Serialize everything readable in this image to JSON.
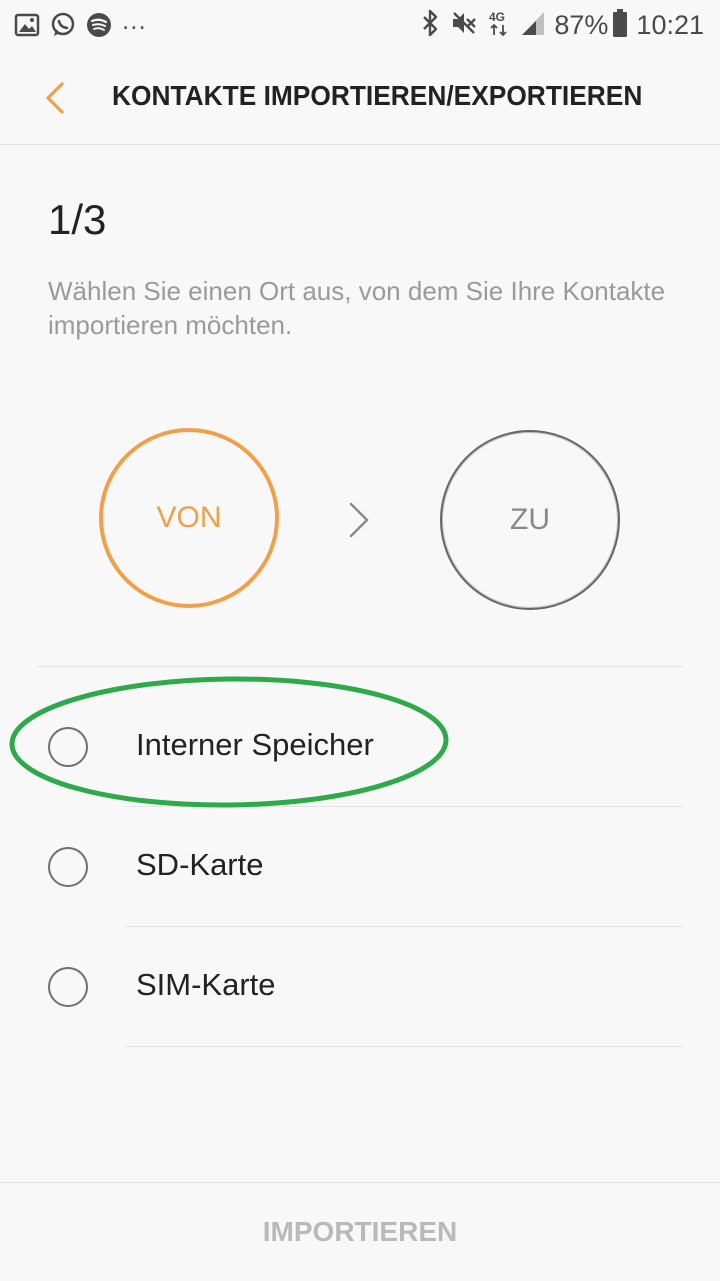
{
  "status_bar": {
    "left_icons": [
      "gallery-icon",
      "whatsapp-icon",
      "spotify-icon"
    ],
    "more": "...",
    "right_icons": [
      "bluetooth-icon",
      "mute-icon",
      "network-4g-icon",
      "signal-icon"
    ],
    "network_type": "4G",
    "battery_percent": "87%",
    "time": "10:21"
  },
  "app_bar": {
    "title": "KONTAKTE IMPORTIEREN/EXPORTIEREN",
    "back_icon": "chevron-left-icon"
  },
  "wizard": {
    "step": "1/3",
    "instruction": "Wählen Sie einen Ort aus, von dem Sie Ihre Kontakte importieren möchten.",
    "from_label": "VON",
    "to_label": "ZU",
    "arrow_icon": "chevron-right-icon"
  },
  "options": [
    {
      "label": "Interner Speicher",
      "selected": false
    },
    {
      "label": "SD-Karte",
      "selected": false
    },
    {
      "label": "SIM-Karte",
      "selected": false
    }
  ],
  "annotation": {
    "shape": "ellipse",
    "color": "#2eaa4a",
    "target": "Interner Speicher"
  },
  "footer": {
    "import_label": "IMPORTIEREN",
    "enabled": false
  },
  "colors": {
    "accent": "#f0a04a",
    "text_primary": "#222222",
    "text_secondary": "#9a9a9a",
    "disabled": "#b9b9b9",
    "background": "#f8f8f8"
  }
}
